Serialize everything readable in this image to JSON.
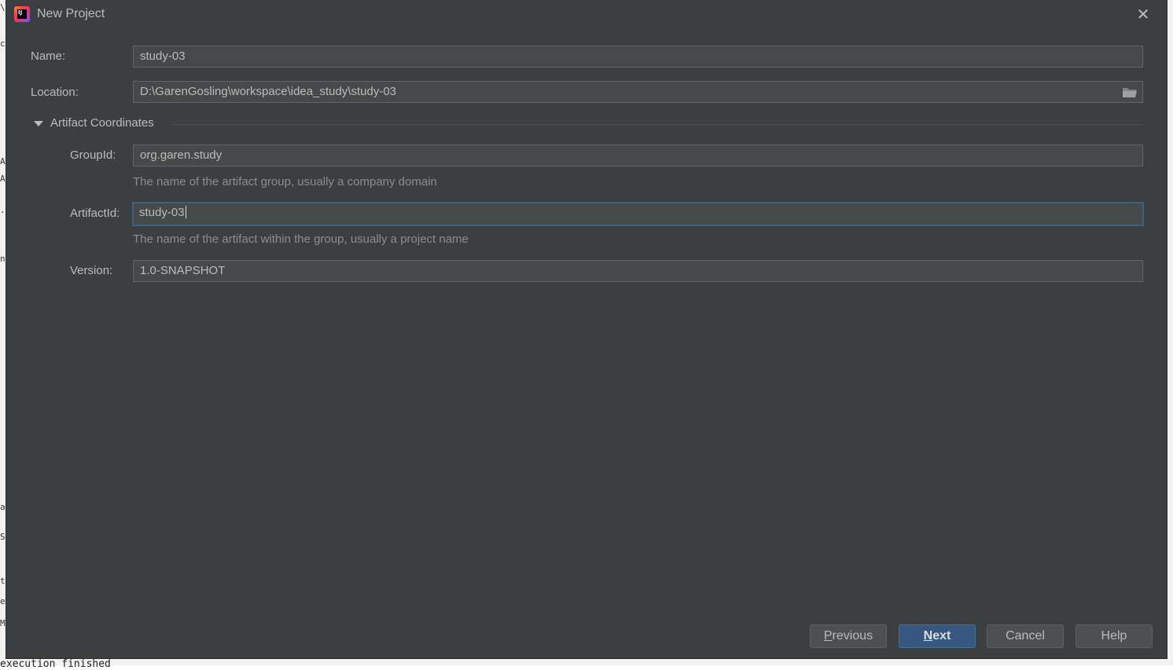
{
  "window": {
    "title": "New Project",
    "close_glyph": "✕",
    "app_icon_text": "IJ"
  },
  "form": {
    "name": {
      "label": "Name:",
      "value": "study-03"
    },
    "location": {
      "label": "Location:",
      "value": "D:\\GarenGosling\\workspace\\idea_study\\study-03"
    },
    "artifact_section": {
      "title": "Artifact Coordinates",
      "expanded": true,
      "group_id": {
        "label": "GroupId:",
        "value": "org.garen.study",
        "hint": "The name of the artifact group, usually a company domain"
      },
      "artifact_id": {
        "label": "ArtifactId:",
        "value": "study-03",
        "hint": "The name of the artifact within the group, usually a project name"
      },
      "version": {
        "label": "Version:",
        "value": "1.0-SNAPSHOT"
      }
    }
  },
  "buttons": {
    "previous": {
      "mnemonic": "P",
      "rest": "revious"
    },
    "next": {
      "mnemonic": "N",
      "rest": "ext"
    },
    "cancel": "Cancel",
    "help": "Help"
  },
  "background_fragments": {
    "bottom_text": "execution finished",
    "left_chars": [
      "\\",
      "c",
      "A",
      "A",
      ".i",
      "ns",
      "al",
      "SI",
      "t",
      "ec",
      "Mc"
    ]
  },
  "colors": {
    "dialog_bg": "#3c3f41",
    "field_bg": "#45494a",
    "focus_border": "#3d6185",
    "primary_button": "#365880",
    "text": "#bbbbbb",
    "hint_text": "#8c8c8c"
  },
  "icons": {
    "app": "intellij-idea-icon",
    "close": "close-icon",
    "browse": "folder-icon",
    "toggle": "triangle-down-icon"
  }
}
